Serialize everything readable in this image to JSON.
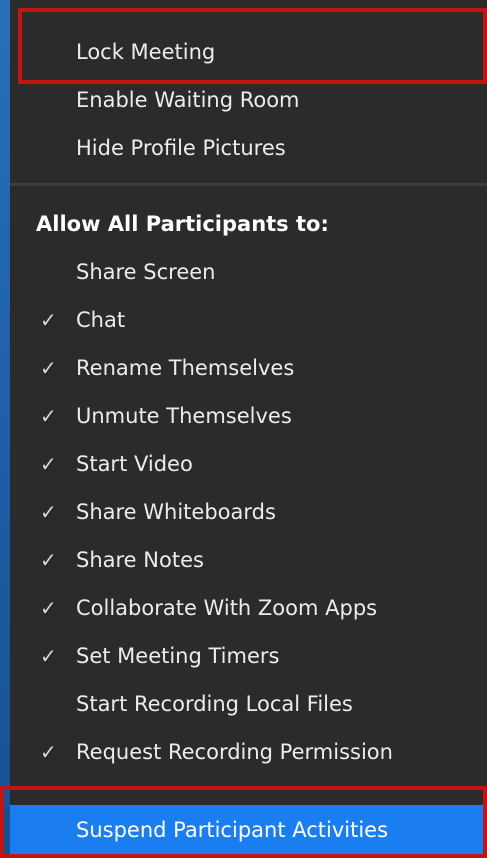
{
  "menu": {
    "top_items": [
      {
        "label": "Lock Meeting",
        "checked": false
      },
      {
        "label": "Enable Waiting Room",
        "checked": false
      },
      {
        "label": "Hide Profile Pictures",
        "checked": false
      }
    ],
    "section_header": "Allow All Participants to:",
    "permission_items": [
      {
        "label": "Share Screen",
        "checked": false
      },
      {
        "label": "Chat",
        "checked": true
      },
      {
        "label": "Rename Themselves",
        "checked": true
      },
      {
        "label": "Unmute Themselves",
        "checked": true
      },
      {
        "label": "Start Video",
        "checked": true
      },
      {
        "label": "Share Whiteboards",
        "checked": true
      },
      {
        "label": "Share Notes",
        "checked": true
      },
      {
        "label": "Collaborate With Zoom Apps",
        "checked": true
      },
      {
        "label": "Set Meeting Timers",
        "checked": true
      },
      {
        "label": "Start Recording Local Files",
        "checked": false
      },
      {
        "label": "Request Recording Permission",
        "checked": true
      }
    ],
    "bottom_item": {
      "label": "Suspend Participant Activities"
    },
    "check_glyph": "✓"
  },
  "colors": {
    "menu_bg": "#2b2b2b",
    "highlight_bg": "#1b7ef0",
    "annotation_red": "#c11414",
    "desktop_blue": "#0c3f7d"
  }
}
